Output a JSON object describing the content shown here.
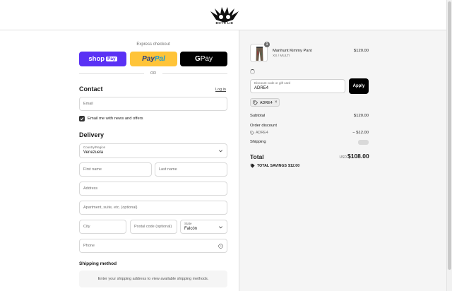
{
  "header": {
    "logo_text": "BOYS LIE"
  },
  "express": {
    "label": "Express checkout",
    "shop_text": "shop",
    "shop_pay": "Pay",
    "paypal_1": "Pay",
    "paypal_2": "Pal",
    "gpay_g": "G",
    "gpay_text": " Pay",
    "or": "OR"
  },
  "contact": {
    "heading": "Contact",
    "login": "Log in",
    "email_placeholder": "Email",
    "news_label": "Email me with news and offers"
  },
  "delivery": {
    "heading": "Delivery",
    "country_label": "Country/Region",
    "country_value": "Venezuela",
    "first_name": "First name",
    "last_name": "Last name",
    "address": "Address",
    "apartment": "Apartment, suite, etc. (optional)",
    "city": "City",
    "postal": "Postal code (optional)",
    "state_label": "State",
    "state_value": "Falcón",
    "phone": "Phone"
  },
  "shipping": {
    "heading": "Shipping method",
    "message": "Enter your shipping address to view available shipping methods."
  },
  "summary": {
    "item": {
      "qty": "1",
      "name": "Manhunt Kimmy Pant",
      "variant": "XS / MULTI",
      "price": "$120.00"
    },
    "discount_label": "Discount code or gift card",
    "discount_value": "ADRE4",
    "apply": "Apply",
    "chip": "ADRE4",
    "subtotal_label": "Subtotal",
    "subtotal_value": "$120.00",
    "order_discount_label": "Order discount",
    "discount_code": "ADRE4",
    "discount_amount": "− $12.00",
    "shipping_label": "Shipping",
    "total_label": "Total",
    "currency": "USD",
    "total_value": "$108.00",
    "savings_label": "TOTAL SAVINGS",
    "savings_value": "$12.00"
  }
}
